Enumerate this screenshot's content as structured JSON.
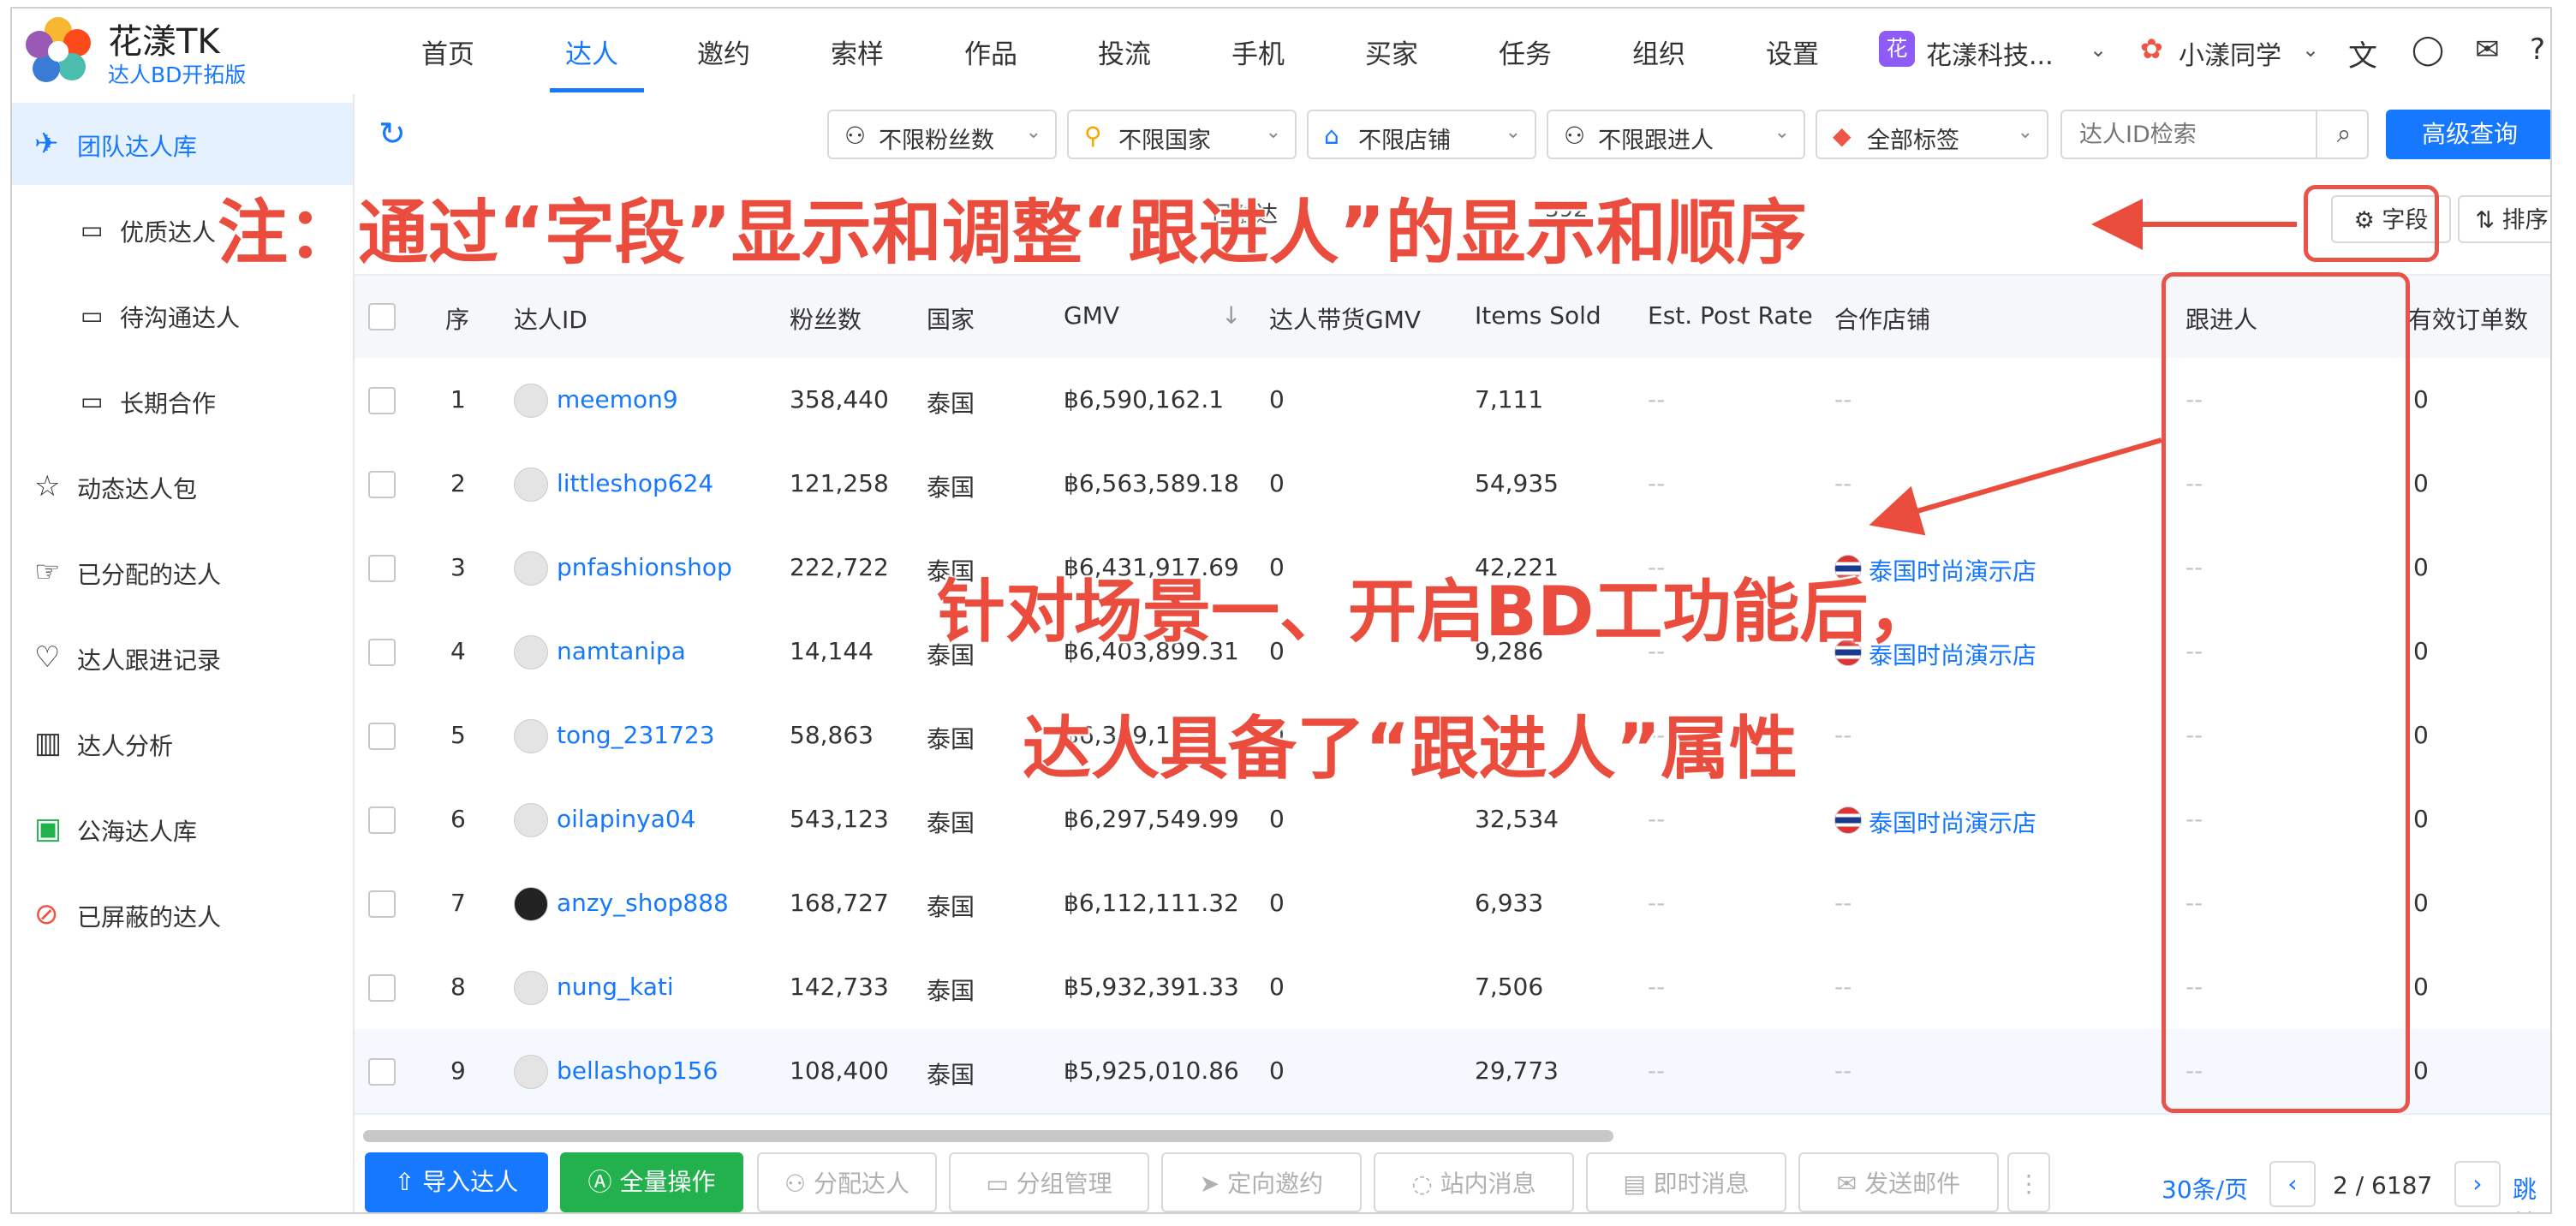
{
  "brand": {
    "name": "花漾TK",
    "sub": "达人BD开拓版"
  },
  "nav": [
    {
      "label": "首页"
    },
    {
      "label": "达人",
      "active": true
    },
    {
      "label": "邀约"
    },
    {
      "label": "索样"
    },
    {
      "label": "作品"
    },
    {
      "label": "投流"
    },
    {
      "label": "手机"
    },
    {
      "label": "买家"
    },
    {
      "label": "任务"
    },
    {
      "label": "组织"
    },
    {
      "label": "设置"
    }
  ],
  "org": {
    "badge": "花",
    "name": "花漾科技..."
  },
  "user": {
    "name": "小漾同学"
  },
  "sidebar": [
    {
      "label": "团队达人库",
      "icon": "team-icon",
      "active": true,
      "sub": false
    },
    {
      "label": "优质达人",
      "icon": "folder-icon",
      "sub": true
    },
    {
      "label": "待沟通达人",
      "icon": "folder-icon",
      "sub": true
    },
    {
      "label": "长期合作",
      "icon": "folder-icon",
      "sub": true
    },
    {
      "label": "动态达人包",
      "icon": "star-icon",
      "sub": false
    },
    {
      "label": "已分配的达人",
      "icon": "hand-icon",
      "sub": false
    },
    {
      "label": "达人跟进记录",
      "icon": "heart-icon",
      "sub": false
    },
    {
      "label": "达人分析",
      "icon": "chart-icon",
      "sub": false
    },
    {
      "label": "公海达人库",
      "icon": "public-icon",
      "sub": false
    },
    {
      "label": "已屏蔽的达人",
      "icon": "block-icon",
      "sub": false
    }
  ],
  "filters": [
    {
      "label": "不限粉丝数",
      "icon": "person-icon"
    },
    {
      "label": "不限国家",
      "icon": "location-icon"
    },
    {
      "label": "不限店铺",
      "icon": "shop-icon"
    },
    {
      "label": "不限跟进人",
      "icon": "person-icon"
    },
    {
      "label": "全部标签",
      "icon": "tag-icon"
    }
  ],
  "search": {
    "placeholder": "达人ID检索"
  },
  "advanced": "高级查询",
  "tabs_partial": {
    "touched": "已触达",
    "count": "392"
  },
  "field_btn": "字段",
  "sort_btn": "排序",
  "columns": [
    "序",
    "达人ID",
    "粉丝数",
    "国家",
    "GMV",
    "达人带货GMV",
    "Items Sold",
    "Est. Post Rate",
    "合作店铺",
    "跟进人",
    "有效订单数"
  ],
  "rows": [
    {
      "idx": "1",
      "id": "meemon9",
      "fans": "358,440",
      "country": "泰国",
      "gmv": "฿6,590,162.1",
      "bd_gmv": "0",
      "sold": "7,111",
      "post_rate": "--",
      "shop": "--",
      "follower": "--",
      "orders": "0"
    },
    {
      "idx": "2",
      "id": "littleshop624",
      "fans": "121,258",
      "country": "泰国",
      "gmv": "฿6,563,589.18",
      "bd_gmv": "0",
      "sold": "54,935",
      "post_rate": "--",
      "shop": "--",
      "follower": "--",
      "orders": "0"
    },
    {
      "idx": "3",
      "id": "pnfashionshop",
      "fans": "222,722",
      "country": "泰国",
      "gmv": "฿6,431,917.69",
      "bd_gmv": "0",
      "sold": "42,221",
      "post_rate": "--",
      "shop": "泰国时尚演示店",
      "follower": "--",
      "orders": "0"
    },
    {
      "idx": "4",
      "id": "namtanipa",
      "fans": "14,144",
      "country": "泰国",
      "gmv": "฿6,403,899.31",
      "bd_gmv": "0",
      "sold": "9,286",
      "post_rate": "--",
      "shop": "泰国时尚演示店",
      "follower": "--",
      "orders": "0"
    },
    {
      "idx": "5",
      "id": "tong_231723",
      "fans": "58,863",
      "country": "泰国",
      "gmv": "฿6,329,193.",
      "bd_gmv": "0",
      "sold": "",
      "post_rate": "--",
      "shop": "--",
      "follower": "--",
      "orders": "0"
    },
    {
      "idx": "6",
      "id": "oilapinya04",
      "fans": "543,123",
      "country": "泰国",
      "gmv": "฿6,297,549.99",
      "bd_gmv": "0",
      "sold": "32,534",
      "post_rate": "--",
      "shop": "泰国时尚演示店",
      "follower": "--",
      "orders": "0"
    },
    {
      "idx": "7",
      "id": "anzy_shop888",
      "fans": "168,727",
      "country": "泰国",
      "gmv": "฿6,112,111.32",
      "bd_gmv": "0",
      "sold": "6,933",
      "post_rate": "--",
      "shop": "--",
      "follower": "--",
      "orders": "0"
    },
    {
      "idx": "8",
      "id": "nung_kati",
      "fans": "142,733",
      "country": "泰国",
      "gmv": "฿5,932,391.33",
      "bd_gmv": "0",
      "sold": "7,506",
      "post_rate": "--",
      "shop": "--",
      "follower": "--",
      "orders": "0"
    },
    {
      "idx": "9",
      "id": "bellashop156",
      "fans": "108,400",
      "country": "泰国",
      "gmv": "฿5,925,010.86",
      "bd_gmv": "0",
      "sold": "29,773",
      "post_rate": "--",
      "shop": "--",
      "follower": "--",
      "orders": "0"
    }
  ],
  "bottom": {
    "import": "导入达人",
    "all_ops": "全量操作",
    "assign": "分配达人",
    "group": "分组管理",
    "invite": "定向邀约",
    "site_msg": "站内消息",
    "im": "即时消息",
    "email": "发送邮件",
    "page_size": "30条/页",
    "page": "2 / 6187",
    "jump": "跳转"
  },
  "annotations": {
    "note1": "注：通过“字段”显示和调整“跟进人”的显示和顺序",
    "note2": "针对场景一、开启BD工功能后，",
    "note3": "达人具备了“跟进人”属性"
  },
  "accent": "#1677ff",
  "annotation_color": "#ea4d3d"
}
